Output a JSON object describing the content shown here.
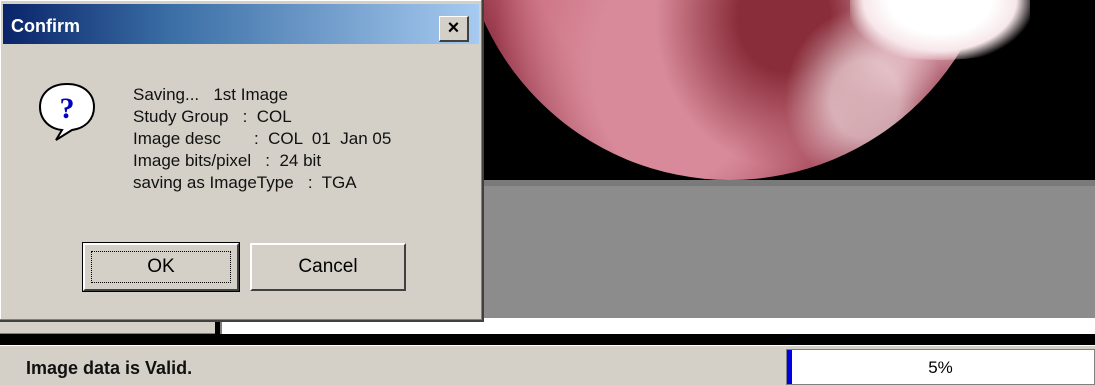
{
  "dialog": {
    "title": "Confirm",
    "close_label": "×",
    "icon": "question-icon",
    "lines": [
      "Saving...   1st Image",
      "Study Group   :  COL",
      "Image desc       :  COL  01  Jan 05",
      "Image bits/pixel   :  24 bit",
      "saving as ImageType   :  TGA"
    ],
    "ok_label": "OK",
    "cancel_label": "Cancel"
  },
  "statusbar": {
    "text": "Image data is Valid.",
    "progress_label": "5%",
    "progress_fraction": 0.05
  },
  "colors": {
    "progress": "#0000e0",
    "title_gradient_start": "#0a246a",
    "title_gradient_end": "#a6caf0"
  }
}
